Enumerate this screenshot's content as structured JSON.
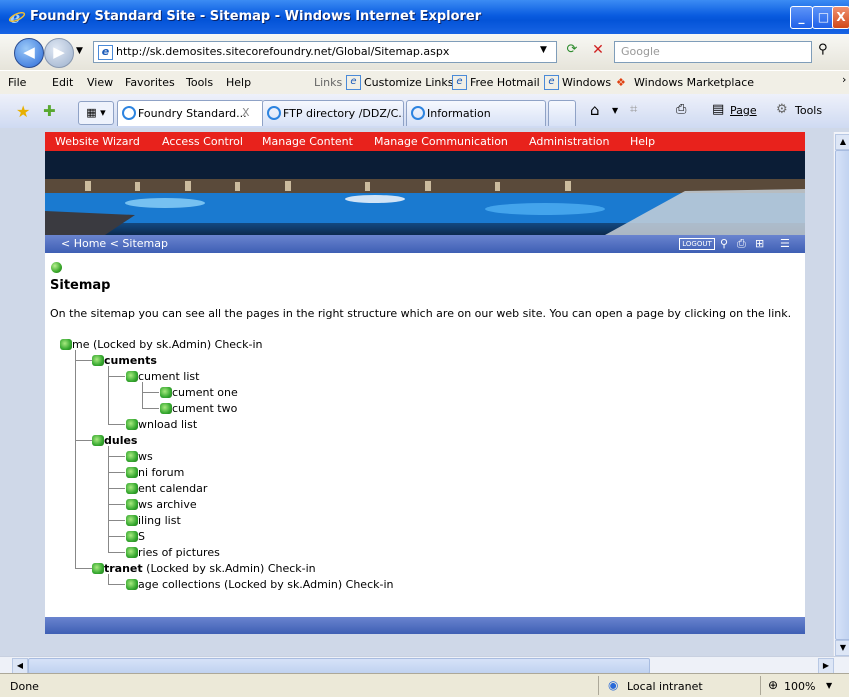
{
  "window": {
    "title": "Foundry Standard Site - Sitemap - Windows Internet Explorer",
    "minimize": "_",
    "maximize": "□",
    "close": "X"
  },
  "address": {
    "url": "http://sk.demosites.sitecorefoundry.net/Global/Sitemap.aspx",
    "search_placeholder": "Google"
  },
  "menu": {
    "items": [
      "File",
      "Edit",
      "View",
      "Favorites",
      "Tools",
      "Help"
    ],
    "links_label": "Links",
    "links": [
      "Customize Links",
      "Free Hotmail",
      "Windows",
      "Windows Marketplace"
    ]
  },
  "tabs": [
    {
      "label": "Foundry Standard...",
      "close": "X"
    },
    {
      "label": "FTP directory /DDZ/C..."
    },
    {
      "label": "Information"
    }
  ],
  "toolbar": {
    "page_label": "Page",
    "tools_label": "Tools"
  },
  "site": {
    "nav": [
      "Website Wizard",
      "Access Control",
      "Manage Content",
      "Manage Communication",
      "Administration",
      "Help"
    ],
    "breadcrumb": "< Home < Sitemap",
    "logout": "LOGOUT",
    "heading": "Sitemap",
    "intro": "On the sitemap you can see all the pages in the right structure which are on our web site. You can open a page by clicking on the link."
  },
  "sitemap": {
    "root": "me (Locked by sk.Admin) Check-in",
    "documents": "cuments",
    "document_list": "cument list",
    "document_one": "cument one",
    "document_two": "cument two",
    "download_list": "wnload list",
    "modules": "dules",
    "news": "ws",
    "mini_forum": "ni forum",
    "event_calendar": "ent calendar",
    "news_archive": "ws archive",
    "mailing_list": "iling list",
    "rss": "S",
    "series_of_pictures": "ries of pictures",
    "extranet_bold": "tranet",
    "extranet_rest": " (Locked by sk.Admin) Check-in",
    "image_collections": "age collections (Locked by sk.Admin) Check-in"
  },
  "status": {
    "left": "Done",
    "zone": "Local intranet",
    "zoom": "100%"
  }
}
